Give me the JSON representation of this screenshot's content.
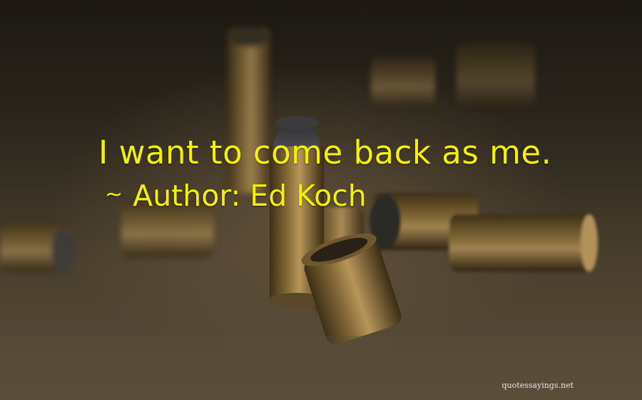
{
  "quote": {
    "text": "I want to come back as me.",
    "author_prefix": "~",
    "author": "Author: Ed Koch"
  },
  "watermark": "quotessayings.net",
  "colors": {
    "text": "#f4f200",
    "background_dark": "#1c1812",
    "brass": "#8a6e3a"
  }
}
